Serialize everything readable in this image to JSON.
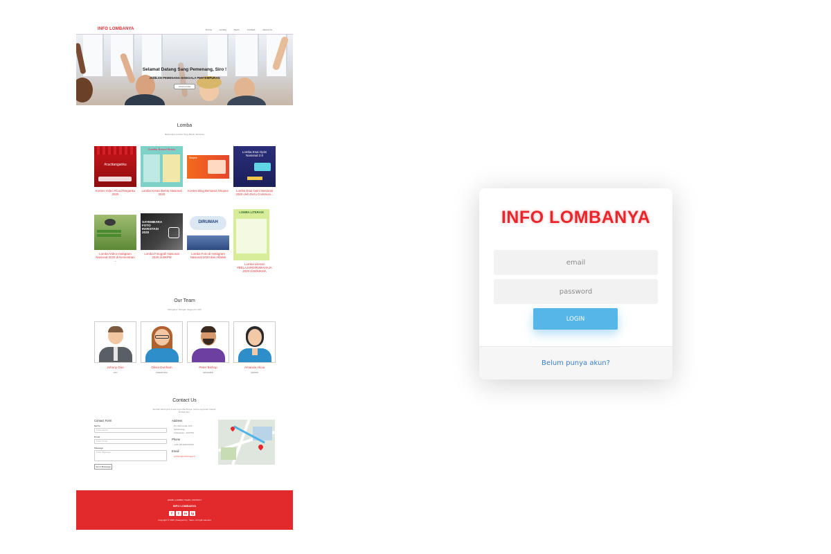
{
  "site": {
    "nav": {
      "logo": "INFO LOMBANYA",
      "links": [
        "Home",
        "Lomba",
        "Team",
        "Contact",
        "About Us"
      ]
    },
    "hero": {
      "title": "Selamat Datang Sang Pemenang, Siro !",
      "subtitle": "JADILAH PEMENANG DISEGALA PERTEMPURAN",
      "button": "Lihat Lomba"
    },
    "lomba": {
      "title": "Lomba",
      "subtitle": "Beberapa Lomba Yang Masih Tersedia",
      "items": [
        {
          "caption": "Kontes Video #CuciTanganku 2020",
          "thumb_text": "#cucitanganku"
        },
        {
          "caption": "Lomba Kreasi Bento Nasional 2020",
          "thumb_text": "Lomba Kreasi Bento"
        },
        {
          "caption": "Kontes Blog Bersama Shopee",
          "thumb_text": "Shopee"
        },
        {
          "caption": "Lomba Esai Opini Nasional 2020 oleh Dicto Communi...",
          "thumb_text": "Lomba Esai Opini Nasional 2.0"
        },
        {
          "caption": "Lomba Video Instagram Nasional 2020 di Kementrian ...",
          "thumb_text": ""
        },
        {
          "caption": "Lomba Fotografi Nasional 2020 di BKPM",
          "thumb_text": "SAYEMBARA FOTO INVESTASI 2020"
        },
        {
          "caption": "Lomba Foto di Instagram Nasional 2020 dari Alfalink",
          "thumb_text": "DIRUMAH"
        },
        {
          "caption": "Lomba Literasi #BELAJARDIRUMAHAJA 2020 di BDUKMA",
          "thumb_text": "LOMBA LITERASI"
        }
      ]
    },
    "team": {
      "title": "Our Team",
      "subtitle": "Mengatur Dengan Segenuh Hati",
      "members": [
        {
          "name": "Johnny Doe",
          "role": "CEO"
        },
        {
          "name": "Olivia Dunham",
          "role": "MARKETING"
        },
        {
          "name": "Peter Bishop",
          "role": "DESIGNER"
        },
        {
          "name": "Amanda Alicia",
          "role": "WRITER"
        }
      ]
    },
    "contact": {
      "title": "Contact Us",
      "subtitle": "Kontak Kami Jika Anda Ingin Bertanya, Sama Layanan Dapat Dilihat Sini",
      "form_title": "Contact Form",
      "name_label": "Name",
      "name_placeholder": "Enter Name",
      "email_label": "Email",
      "email_placeholder": "Enter Email",
      "message_label": "Message",
      "message_placeholder": "Enter Message",
      "send": "Send Message",
      "address_label": "Address",
      "address_lines": [
        "Jln. Pamunda 123 ,",
        "Semarang ,",
        "Indonesia , 123750"
      ],
      "phone_label": "Phone",
      "phone": "+62 (821)0012320",
      "email_info_label": "Email",
      "email_value": "admin@lombanya.id"
    },
    "footer": {
      "links": "HOME | LOMBA | TEAM | CONTACT",
      "logo": "INFO LOMBANYA",
      "icons": [
        "f",
        "t",
        "in",
        "ig"
      ],
      "copyright": "Copyright © 2020 | Designed by : Yasiro, All right reserved"
    }
  },
  "login": {
    "logo": "INFO LOMBANYA",
    "email_placeholder": "email",
    "password_placeholder": "password",
    "login_button": "LOGIN",
    "register_link": "Belum punya akun?"
  },
  "colors": {
    "brand_red": "#e8262b",
    "login_blue": "#56b6e8",
    "link_blue": "#3d7fc7",
    "footer_red": "#e2292b"
  }
}
